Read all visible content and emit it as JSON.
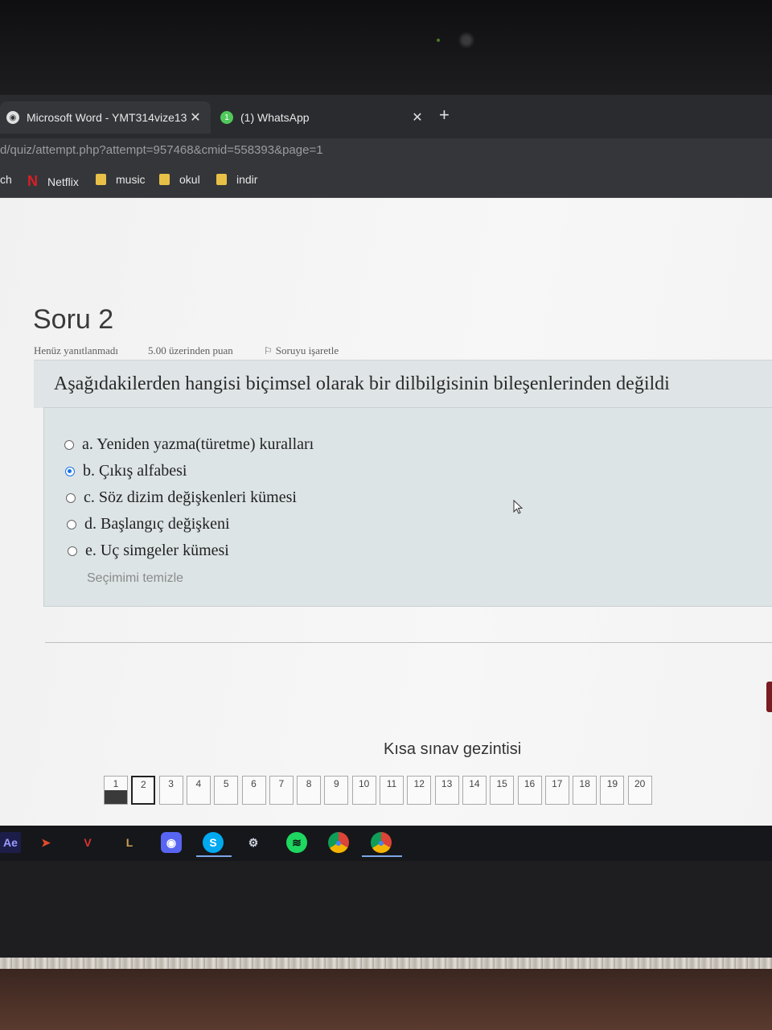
{
  "browser": {
    "tabs": [
      {
        "title": "Microsoft Word - YMT314vize13",
        "active": true
      },
      {
        "title": "(1) WhatsApp",
        "active": false
      }
    ],
    "url": "d/quiz/attempt.php?attempt=957468&cmid=558393&page=1",
    "bookmarks": [
      "ch",
      "Netflix",
      "music",
      "okul",
      "indir"
    ]
  },
  "question": {
    "title": "Soru 2",
    "status": "Henüz yanıtlanmadı",
    "points": "5.00 üzerinden puan",
    "flag": "Soruyu işaretle",
    "text": "Aşağıdakilerden hangisi biçimsel olarak bir dilbilgisinin bileşenlerinden değildi",
    "options": [
      {
        "label": "a. Yeniden yazma(türetme) kuralları",
        "selected": false
      },
      {
        "label": "b. Çıkış alfabesi",
        "selected": true
      },
      {
        "label": "c. Söz dizim değişkenleri kümesi",
        "selected": false
      },
      {
        "label": "d. Başlangıç değişkeni",
        "selected": false
      },
      {
        "label": "e. Uç simgeler kümesi",
        "selected": false
      }
    ],
    "clear_choice": "Seçimimi temizle"
  },
  "navigation": {
    "title": "Kısa sınav gezintisi",
    "buttons": [
      "1",
      "2",
      "3",
      "4",
      "5",
      "6",
      "7",
      "8",
      "9",
      "10",
      "11",
      "12",
      "13",
      "14",
      "15",
      "16",
      "17",
      "18",
      "19",
      "20"
    ],
    "answered": [
      "1"
    ],
    "current": "2"
  },
  "taskbar": {
    "apps": [
      "Ae",
      "arrow-icon",
      "vivaldi-icon",
      "league-icon",
      "discord-icon",
      "skype-icon",
      "steam-icon",
      "spotify-icon",
      "chrome-icon",
      "chrome-icon"
    ]
  },
  "colors": {
    "selected_radio": "#1a73e8",
    "question_box": "#dde4e6",
    "tabbar": "#2a2b2f"
  }
}
